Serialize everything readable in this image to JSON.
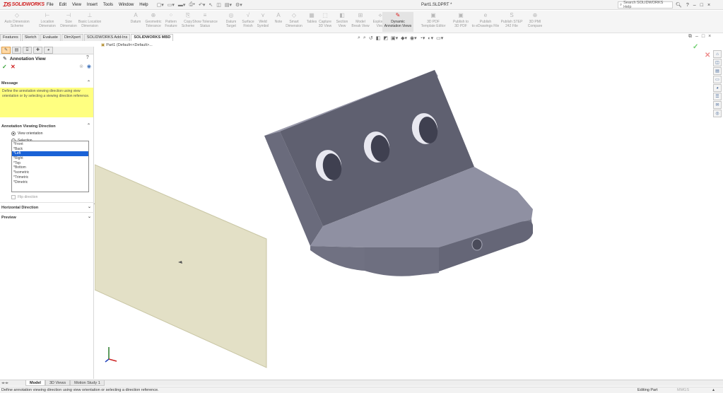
{
  "app": {
    "logo": "SOLIDWORKS",
    "document_title": "Part1.SLDPRT *",
    "menus": [
      "File",
      "Edit",
      "View",
      "Insert",
      "Tools",
      "Window",
      "Help"
    ],
    "search_placeholder": "Search SOLIDWORKS Help",
    "window_controls": [
      "?",
      "–",
      "□",
      "×"
    ]
  },
  "command_manager": {
    "commands": [
      {
        "label": "Auto Dimension\nScheme",
        "icon": "auto-dimension-icon",
        "state": "disabled"
      },
      {
        "label": "Location\nDimension",
        "icon": "location-dimension-icon",
        "state": "disabled"
      },
      {
        "label": "Size\nDimension",
        "icon": "size-dimension-icon",
        "state": "disabled"
      },
      {
        "label": "Basic Location Dimension",
        "icon": "basic-location-dimension-icon",
        "state": "disabled"
      },
      {
        "label": "Datum",
        "icon": "datum-icon",
        "state": "disabled"
      },
      {
        "label": "Geometric\nTolerance",
        "icon": "geometric-tolerance-icon",
        "state": "disabled"
      },
      {
        "label": "Pattern\nFeature",
        "icon": "pattern-feature-icon",
        "state": "disabled"
      },
      {
        "label": "Copy\nScheme",
        "icon": "copy-scheme-icon",
        "state": "disabled"
      },
      {
        "label": "Show Tolerance\nStatus",
        "icon": "tolerance-status-icon",
        "state": "disabled"
      },
      {
        "label": "Datum\nTarget",
        "icon": "datum-target-icon",
        "state": "disabled"
      },
      {
        "label": "Surface\nFinish",
        "icon": "surface-finish-icon",
        "state": "disabled"
      },
      {
        "label": "Weld\nSymbol",
        "icon": "weld-symbol-icon",
        "state": "disabled"
      },
      {
        "label": "Note",
        "icon": "note-icon",
        "state": "disabled"
      },
      {
        "label": "Smart\nDimension",
        "icon": "smart-dimension-icon",
        "state": "disabled"
      },
      {
        "label": "Tables",
        "icon": "tables-icon",
        "state": "disabled"
      },
      {
        "label": "Capture\n3D View",
        "icon": "capture-3d-view-icon",
        "state": "disabled"
      },
      {
        "label": "Section\nView",
        "icon": "section-view-icon",
        "state": "disabled"
      },
      {
        "label": "Model\nBreak View",
        "icon": "model-break-view-icon",
        "state": "disabled"
      },
      {
        "label": "Exploded\nView",
        "icon": "exploded-view-icon",
        "state": "disabled"
      },
      {
        "label": "Dynamic\nAnnotation Views",
        "icon": "dynamic-annotation-views-icon",
        "state": "active"
      },
      {
        "label": "3D PDF\nTemplate Editor",
        "icon": "3d-pdf-template-icon",
        "state": "disabled"
      },
      {
        "label": "Publish to\n3D PDF",
        "icon": "publish-3d-pdf-icon",
        "state": "disabled"
      },
      {
        "label": "Publish\nto eDrawings File",
        "icon": "publish-edrawings-icon",
        "state": "disabled"
      },
      {
        "label": "Publish STEP\n242 File",
        "icon": "publish-step-icon",
        "state": "disabled"
      },
      {
        "label": "3D PMI\nCompare",
        "icon": "3d-pmi-compare-icon",
        "state": "disabled"
      }
    ],
    "tabs": [
      "Features",
      "Sketch",
      "Evaluate",
      "DimXpert",
      "SOLIDWORKS Add-Ins",
      "SOLIDWORKS MBD"
    ],
    "active_tab": "SOLIDWORKS MBD"
  },
  "property_manager": {
    "title": "Annotation View",
    "help_icon": "?",
    "message_header": "Message",
    "message": "Define the annotation viewing direction using view orientation or by selecting a viewing direction reference.",
    "viewing_direction_header": "Annotation Viewing Direction",
    "radio_view_orientation": "View orientation",
    "radio_selection": "Selection",
    "orientations": [
      "*Front",
      "*Back",
      "*Left",
      "*Right",
      "*Top",
      "*Bottom",
      "*Isometric",
      "*Trimetric",
      "*Dimetric"
    ],
    "selected_orientation": "*Left",
    "flip_direction": "Flip direction",
    "horizontal_direction_header": "Horizontal Direction",
    "preview_header": "Preview"
  },
  "graphics": {
    "tree_crumb": "Part1 (Default<<Default>...",
    "colors": {
      "plane": "#e3e0c6",
      "plane_edge": "#c9c6a4",
      "part_dark": "#5f6070",
      "part_mid": "#777889",
      "part_light": "#9a9aab",
      "part_face": "#8a8b9c"
    }
  },
  "bottom_tabs": [
    "Model",
    "3D Views",
    "Motion Study 1"
  ],
  "active_bottom_tab": "Model",
  "status": {
    "text": "Define annotation viewing direction using view orientation or selecting a direction reference.",
    "mode": "Editing Part",
    "units": "MMGS"
  }
}
